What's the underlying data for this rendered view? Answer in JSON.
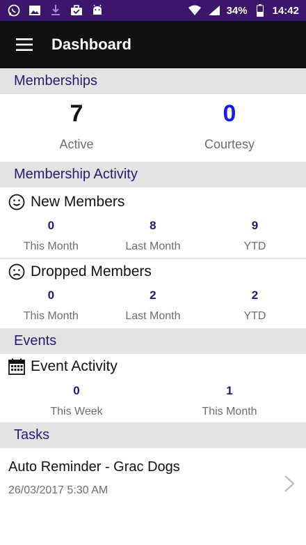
{
  "status_bar": {
    "battery": "34%",
    "time": "14:42",
    "icons_left": [
      "whatsapp-icon",
      "image-icon",
      "download-icon",
      "briefcase-check-icon",
      "android-icon"
    ],
    "icons_right": [
      "wifi-icon",
      "signal-icon",
      "battery-icon"
    ]
  },
  "app_bar": {
    "title": "Dashboard",
    "menu_icon": "hamburger-menu-icon"
  },
  "memberships": {
    "header": "Memberships",
    "active": {
      "value": "7",
      "label": "Active",
      "color": "#111111"
    },
    "courtesy": {
      "value": "0",
      "label": "Courtesy",
      "color": "#1a1aee"
    }
  },
  "membership_activity": {
    "header": "Membership Activity",
    "new_members": {
      "title": "New Members",
      "icon": "smile-icon",
      "stats": [
        {
          "value": "0",
          "label": "This Month"
        },
        {
          "value": "8",
          "label": "Last Month"
        },
        {
          "value": "9",
          "label": "YTD"
        }
      ]
    },
    "dropped_members": {
      "title": "Dropped Members",
      "icon": "frown-icon",
      "stats": [
        {
          "value": "0",
          "label": "This Month"
        },
        {
          "value": "2",
          "label": "Last Month"
        },
        {
          "value": "2",
          "label": "YTD"
        }
      ]
    }
  },
  "events": {
    "header": "Events",
    "event_activity": {
      "title": "Event Activity",
      "icon": "calendar-icon",
      "stats": [
        {
          "value": "0",
          "label": "This Week"
        },
        {
          "value": "1",
          "label": "This Month"
        }
      ]
    }
  },
  "tasks": {
    "header": "Tasks",
    "items": [
      {
        "title": "Auto Reminder - Grac Dogs",
        "date": "26/03/2017 5:30 AM"
      }
    ]
  },
  "colors": {
    "status_bar": "#3b166a",
    "app_bar": "#111111",
    "section_header_bg": "#e3e3e3",
    "section_header_text": "#2a1a6e",
    "stat_number": "#1f1a6e"
  }
}
